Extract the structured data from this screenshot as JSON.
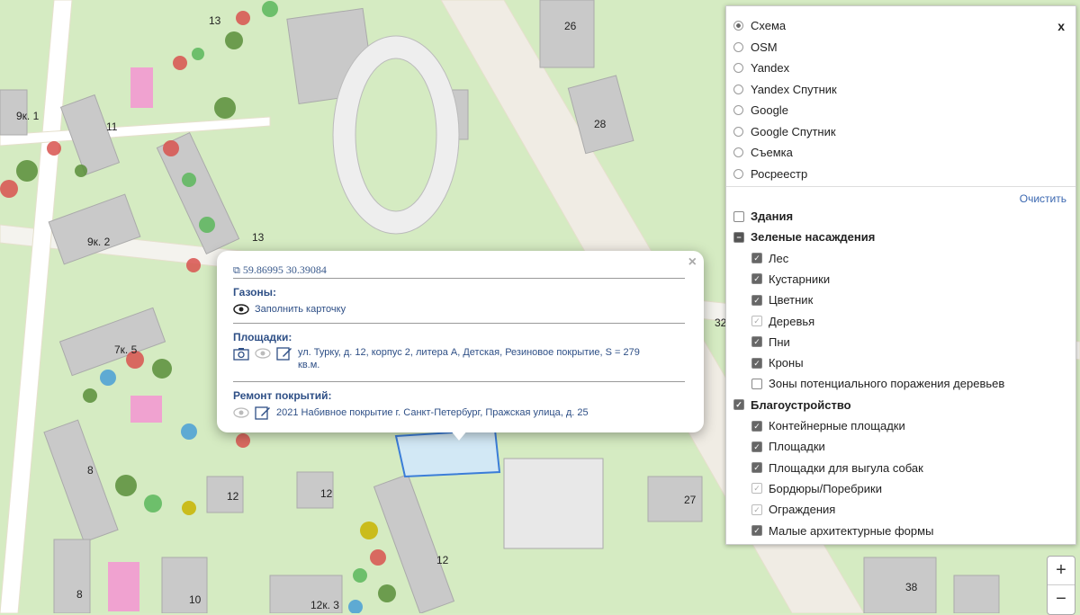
{
  "map": {
    "building_labels": [
      "13",
      "26",
      "9к. 1",
      "11",
      "28",
      "9к. 2",
      "13",
      "7к. 5",
      "8",
      "12",
      "12",
      "27",
      "32",
      "8",
      "10",
      "12к. 3",
      "12",
      "38"
    ]
  },
  "popup": {
    "close": "×",
    "coords": "59.86995 30.39084",
    "section1_title": "Газоны:",
    "section1_link": "Заполнить карточку",
    "section2_title": "Площадки:",
    "section2_text": "ул. Турку, д. 12, корпус 2, литера А, Детская, Резиновое покрытие, S = 279 кв.м.",
    "section3_title": "Ремонт покрытий:",
    "section3_text": "2021 Набивное покрытие г. Санкт-Петербург, Пражская улица, д. 25"
  },
  "panel": {
    "close": "x",
    "basemaps": [
      {
        "label": "Схема",
        "selected": true
      },
      {
        "label": "OSM",
        "selected": false
      },
      {
        "label": "Yandex",
        "selected": false
      },
      {
        "label": "Yandex Спутник",
        "selected": false
      },
      {
        "label": "Google",
        "selected": false
      },
      {
        "label": "Google Спутник",
        "selected": false
      },
      {
        "label": "Съемка",
        "selected": false
      },
      {
        "label": "Росреестр",
        "selected": false
      }
    ],
    "clear": "Очистить",
    "groups": [
      {
        "label": "Здания",
        "state": "off",
        "bold": true
      },
      {
        "label": "Зеленые насаждения",
        "state": "partial",
        "bold": true
      },
      {
        "label": "Лес",
        "state": "on"
      },
      {
        "label": "Кустарники",
        "state": "on"
      },
      {
        "label": "Цветник",
        "state": "on"
      },
      {
        "label": "Деревья",
        "state": "disabled"
      },
      {
        "label": "Пни",
        "state": "on"
      },
      {
        "label": "Кроны",
        "state": "on"
      },
      {
        "label": "Зоны потенциального поражения деревьев",
        "state": "off"
      },
      {
        "label": "Благоустройство",
        "state": "on",
        "bold": true
      },
      {
        "label": "Контейнерные площадки",
        "state": "on"
      },
      {
        "label": "Площадки",
        "state": "on"
      },
      {
        "label": "Площадки для выгула собак",
        "state": "on"
      },
      {
        "label": "Бордюры/Поребрики",
        "state": "disabled"
      },
      {
        "label": "Ограждения",
        "state": "disabled"
      },
      {
        "label": "Малые архитектурные формы",
        "state": "on"
      }
    ]
  },
  "zoom": {
    "in": "+",
    "out": "−"
  }
}
